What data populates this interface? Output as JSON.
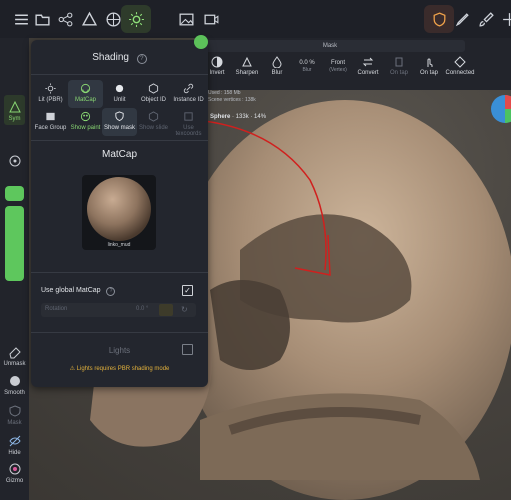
{
  "panel": {
    "title": "Shading",
    "modes_row1": [
      {
        "label": "Lit (PBR)",
        "icon": "sun-icon"
      },
      {
        "label": "MatCap",
        "icon": "matcap-icon"
      },
      {
        "label": "Unlit",
        "icon": "dot-icon"
      },
      {
        "label": "Object ID",
        "icon": "cube-icon"
      },
      {
        "label": "Instance ID",
        "icon": "link-icon"
      }
    ],
    "modes_row2": [
      {
        "label": "Face Group",
        "icon": "face-group-icon"
      },
      {
        "label": "Show paint",
        "icon": "paint-icon"
      },
      {
        "label": "Show mask",
        "icon": "shield-icon"
      },
      {
        "label": "Show slide",
        "icon": "slide-icon"
      },
      {
        "label": "Use texcoords",
        "icon": "uv-icon"
      }
    ],
    "selected_mode": "MatCap",
    "matcap_title": "MatCap",
    "matcap_name": "linko_mud",
    "use_global_matcap_label": "Use global MatCap",
    "use_global_matcap_checked": "✓",
    "rotation_label": "Rotation",
    "rotation_value": "0.0 °",
    "lights_label": "Lights",
    "warning": "Lights requires PBR shading mode"
  },
  "toolbar": {
    "mask_label": "Mask",
    "tools": [
      {
        "label": "Invert",
        "sub": "",
        "icon": "invert-icon"
      },
      {
        "label": "Sharpen",
        "sub": "",
        "icon": "sharpen-icon"
      },
      {
        "label": "Blur",
        "sub": "",
        "icon": "blur-icon"
      },
      {
        "label": "0.0 %",
        "sub": "Blur",
        "icon": "percent-icon"
      },
      {
        "label": "Front",
        "sub": "(Vertex)",
        "icon": "front-icon"
      },
      {
        "label": "Convert",
        "sub": "",
        "icon": "convert-icon"
      },
      {
        "label": "On tap",
        "sub": "",
        "icon": "tap-icon"
      },
      {
        "label": "On tap",
        "sub": "",
        "icon": "tap2-icon"
      },
      {
        "label": "Connected",
        "sub": "",
        "icon": "connected-icon"
      }
    ]
  },
  "status": {
    "used": "Used : 158 Mb",
    "vertices": "Scene vertices : 138k",
    "object_name": "Sphere",
    "object_stats": "· 133k · 14%"
  },
  "leftbar": {
    "sym_label": "Sym",
    "unmask_label": "Unmask",
    "smooth_label": "Smooth",
    "mask_label": "Mask",
    "hide_label": "Hide",
    "gizmo_label": "Gizmo"
  },
  "colors": {
    "accent_green": "#89d773",
    "annotation_red": "#d0201e",
    "warning": "#e2b13c"
  }
}
